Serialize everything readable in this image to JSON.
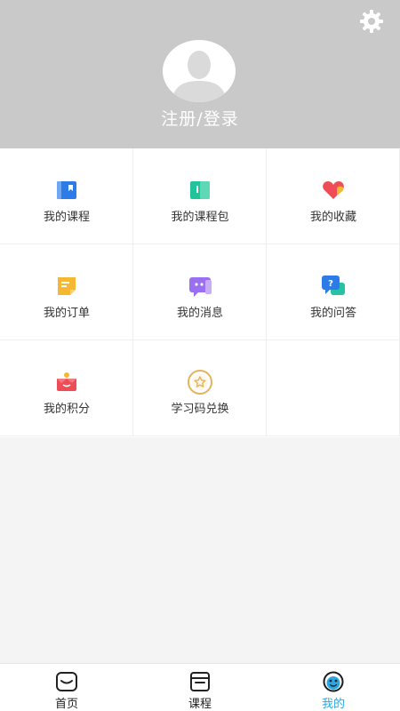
{
  "header": {
    "login_label": "注册/登录",
    "settings_icon": "gear-icon",
    "avatar_icon": "avatar-placeholder"
  },
  "menu": [
    {
      "label": "我的课程",
      "icon": "course-book-icon"
    },
    {
      "label": "我的课程包",
      "icon": "course-package-icon"
    },
    {
      "label": "我的收藏",
      "icon": "favorite-heart-icon"
    },
    {
      "label": "我的订单",
      "icon": "order-note-icon"
    },
    {
      "label": "我的消息",
      "icon": "message-bubble-icon"
    },
    {
      "label": "我的问答",
      "icon": "qa-bubble-icon"
    },
    {
      "label": "我的积分",
      "icon": "points-gift-icon"
    },
    {
      "label": "学习码兑换",
      "icon": "redeem-star-icon"
    }
  ],
  "tabs": [
    {
      "label": "首页",
      "icon": "home-icon",
      "active": false
    },
    {
      "label": "课程",
      "icon": "course-icon",
      "active": false
    },
    {
      "label": "我的",
      "icon": "profile-icon",
      "active": true
    }
  ],
  "colors": {
    "header_bg": "#c9c9c9",
    "active_tab": "#2aa8e6",
    "page_bg": "#f4f4f4"
  }
}
